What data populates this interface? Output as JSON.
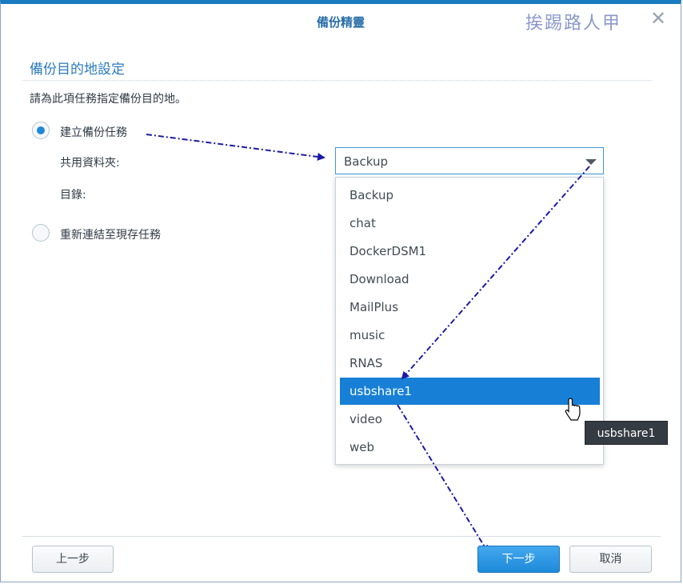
{
  "window": {
    "title": "備份精靈",
    "watermark": "挨踢路人甲"
  },
  "section": {
    "title": "備份目的地設定",
    "description": "請為此項任務指定備份目的地。"
  },
  "options": {
    "create_task": "建立備份任務",
    "relink_task": "重新連結至現存任務"
  },
  "fields": {
    "shared_folder_label": "共用資料夾:",
    "directory_label": "目錄:"
  },
  "combo": {
    "value": "Backup"
  },
  "dropdown": {
    "items": [
      "Backup",
      "chat",
      "DockerDSM1",
      "Download",
      "MailPlus",
      "music",
      "RNAS",
      "usbshare1",
      "video",
      "web"
    ],
    "highlighted": "usbshare1"
  },
  "tooltip": {
    "text": "usbshare1"
  },
  "footer": {
    "back": "上一步",
    "next": "下一步",
    "cancel": "取消"
  },
  "colors": {
    "accent": "#1780d6",
    "annotation_arrow": "#1a1aa8"
  }
}
